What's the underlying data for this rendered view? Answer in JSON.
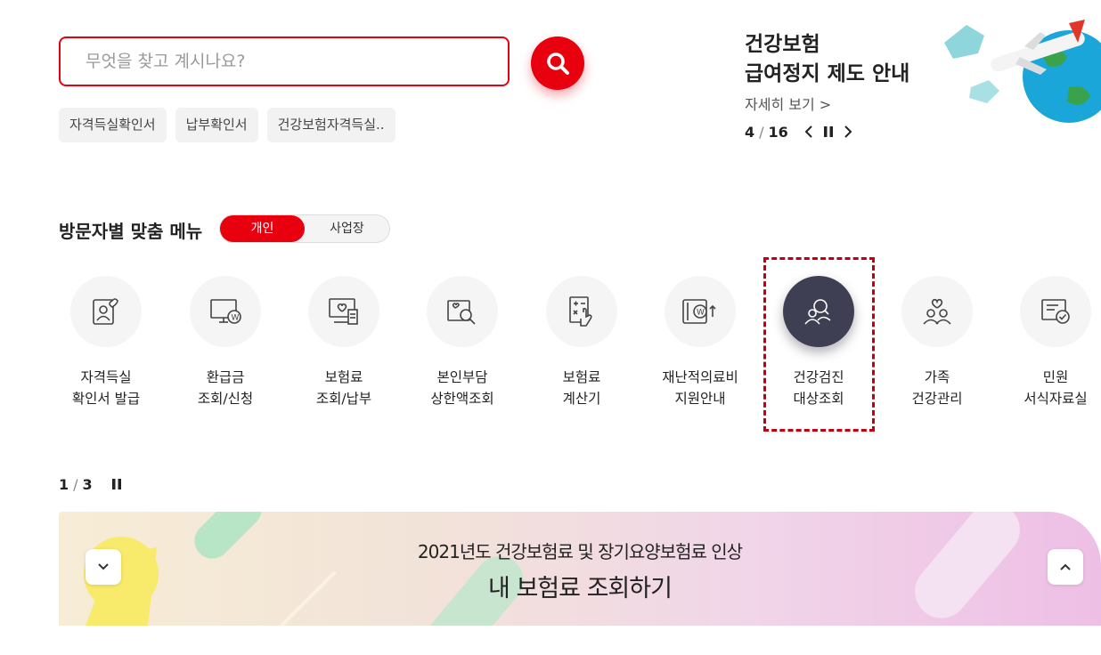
{
  "search": {
    "placeholder": "무엇을 찾고 계시나요?",
    "value": ""
  },
  "quick_links": [
    "자격득실확인서",
    "납부확인서",
    "건강보험자격득실.."
  ],
  "banner": {
    "title_line1": "건강보험",
    "title_line2": "급여정지 제도 안내",
    "more_label": "자세히 보기 >",
    "current": "4",
    "separator": "/",
    "total": "16"
  },
  "visitor_menu": {
    "title": "방문자별 맞춤 메뉴",
    "tabs": [
      "개인",
      "사업장"
    ],
    "selected_tab": "개인"
  },
  "menu_items": [
    {
      "label": "자격득실\n확인서 발급",
      "icon": "person-card-icon"
    },
    {
      "label": "환급금\n조회/신청",
      "icon": "monitor-won-icon"
    },
    {
      "label": "보험료\n조회/납부",
      "icon": "bill-heart-icon"
    },
    {
      "label": "본인부담\n상한액조회",
      "icon": "search-heart-icon"
    },
    {
      "label": "보험료\n계산기",
      "icon": "calculator-hand-icon"
    },
    {
      "label": "재난적의료비\n지원안내",
      "icon": "won-support-icon"
    },
    {
      "label": "건강검진\n대상조회",
      "icon": "checkup-search-icon",
      "active": true
    },
    {
      "label": "가족\n건강관리",
      "icon": "family-heart-icon"
    },
    {
      "label": "민원\n서식자료실",
      "icon": "document-check-icon"
    }
  ],
  "slide_pager": {
    "current": "1",
    "separator": "/",
    "total": "3"
  },
  "promo": {
    "subtitle": "2021년도 건강보험료 및 장기요양보험료 인상",
    "title": "내 보험료 조회하기"
  },
  "colors": {
    "accent": "#e8000f",
    "active_icon_bg": "#3f3f54",
    "highlight_border": "#c00010"
  }
}
